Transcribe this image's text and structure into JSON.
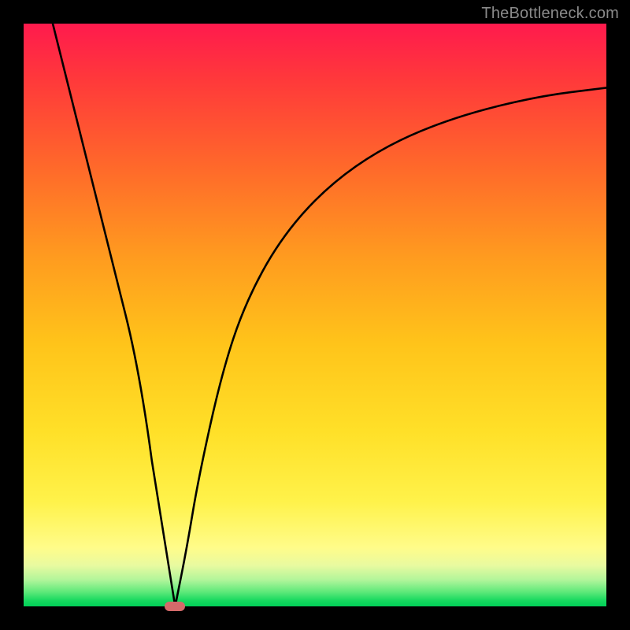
{
  "watermark": "TheBottleneck.com",
  "chart_data": {
    "type": "line",
    "title": "",
    "xlabel": "",
    "ylabel": "",
    "xlim": [
      0,
      100
    ],
    "ylim": [
      0,
      100
    ],
    "grid": false,
    "legend": false,
    "series": [
      {
        "name": "curve-left",
        "x": [
          5,
          10,
          15,
          20,
          24,
          26
        ],
        "values": [
          100,
          80,
          60,
          40,
          10,
          0
        ]
      },
      {
        "name": "curve-right",
        "x": [
          26,
          28,
          30,
          34,
          38,
          44,
          52,
          62,
          74,
          88,
          100
        ],
        "values": [
          0,
          10,
          22,
          40,
          52,
          63,
          72,
          79,
          84,
          87.5,
          89
        ]
      }
    ],
    "marker": {
      "x": 26,
      "y": 0,
      "color": "#d46a6a"
    },
    "gradient_stops": [
      {
        "pos": 0,
        "color": "#ff1a4d"
      },
      {
        "pos": 50,
        "color": "#ffc41a"
      },
      {
        "pos": 85,
        "color": "#fff24a"
      },
      {
        "pos": 100,
        "color": "#00d058"
      }
    ]
  }
}
